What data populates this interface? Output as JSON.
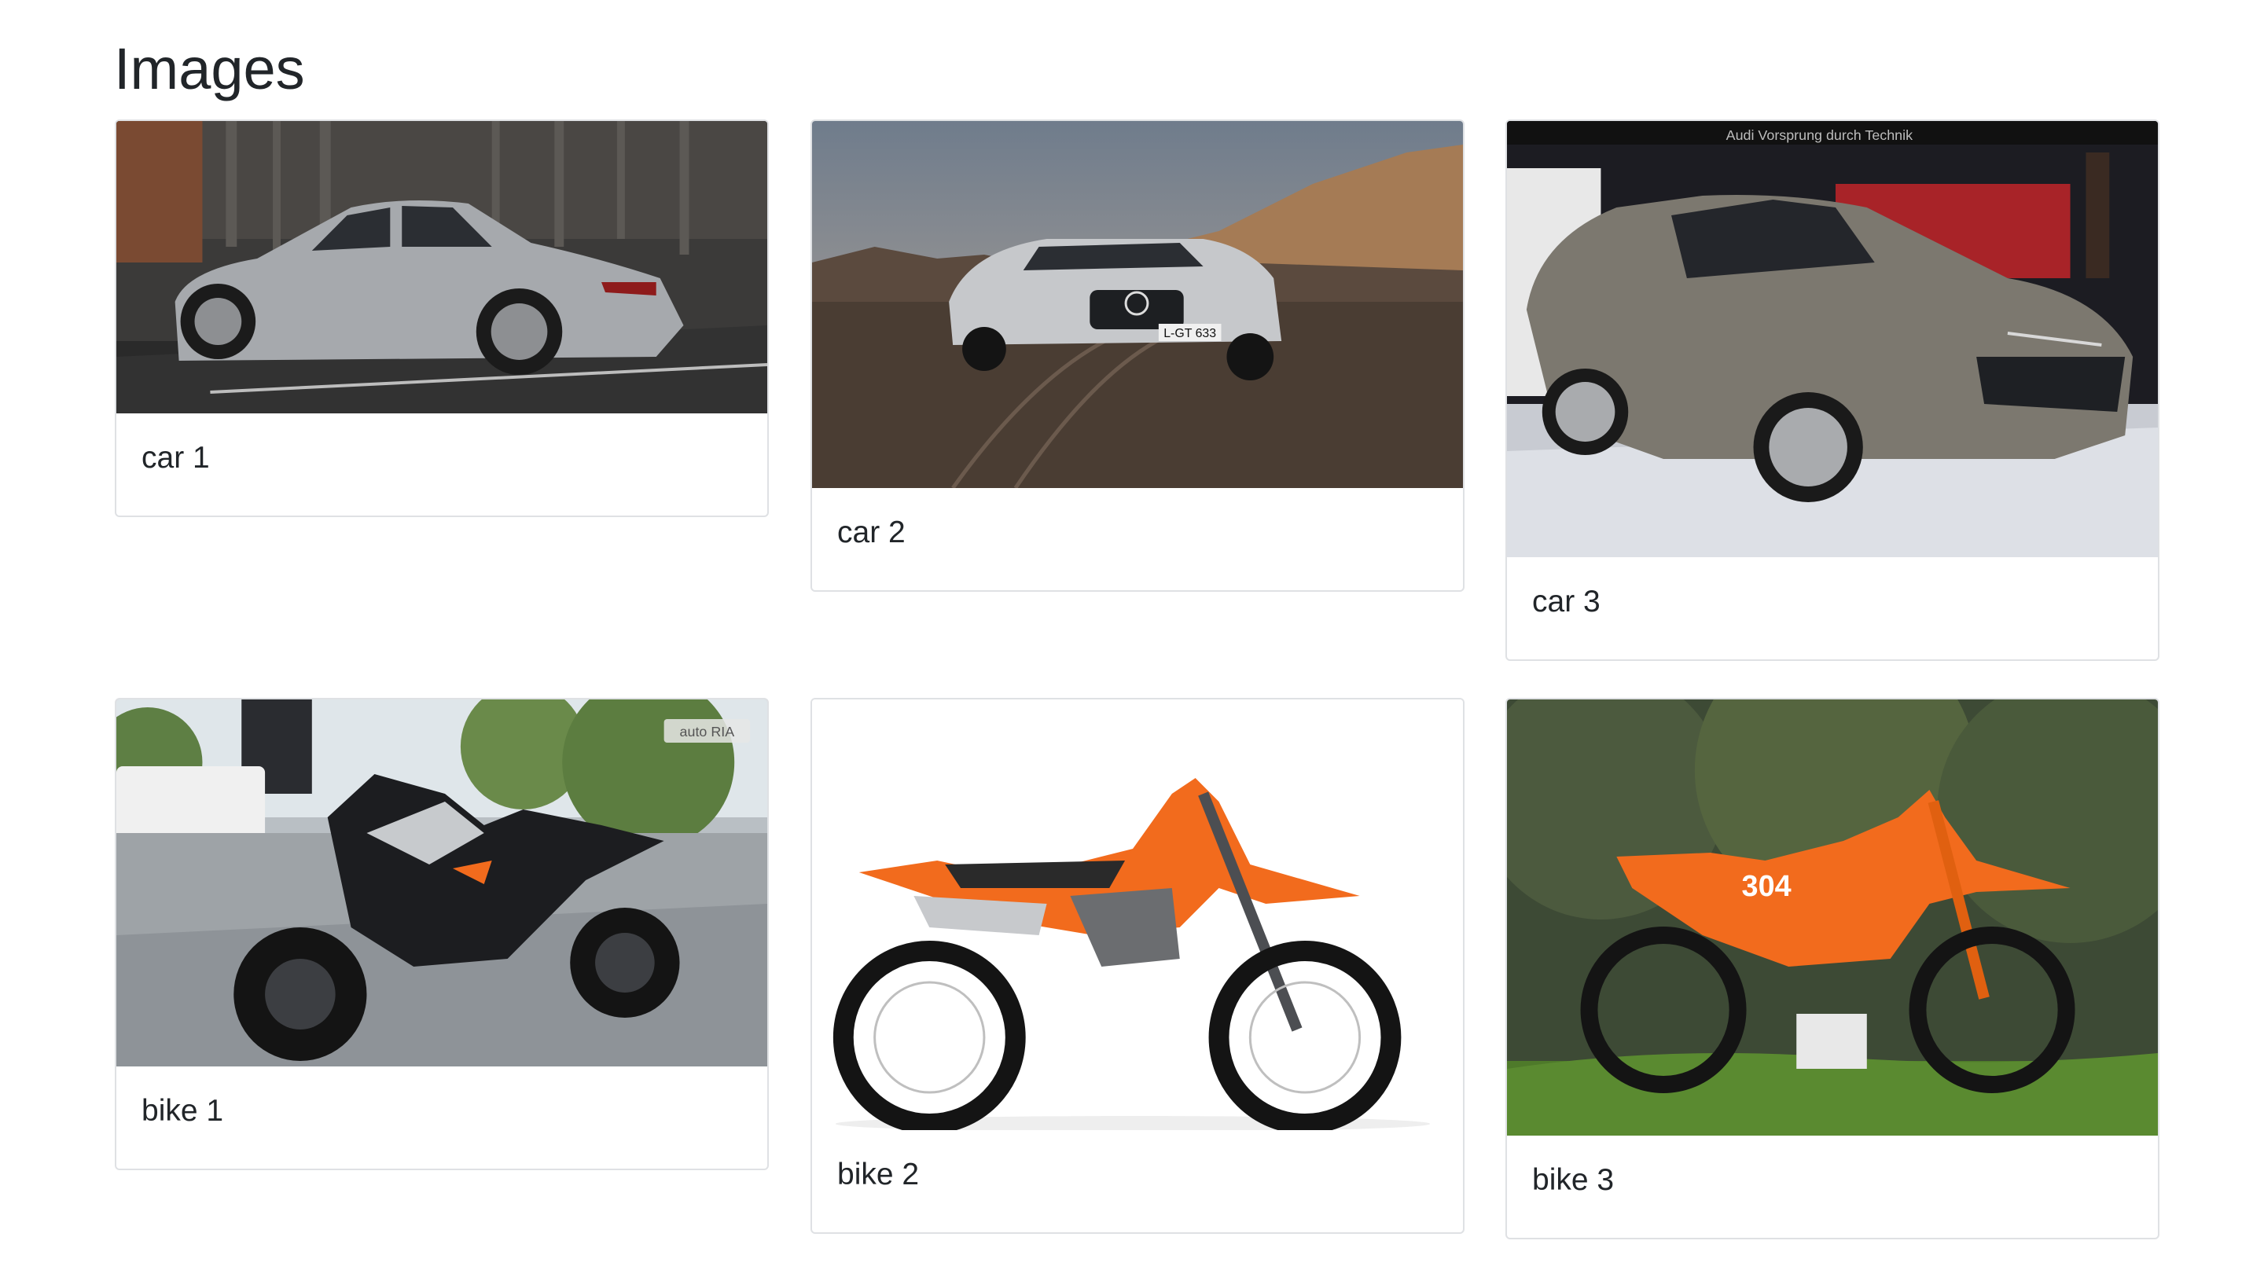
{
  "page": {
    "title": "Images"
  },
  "cards": [
    {
      "title": "car 1",
      "image_alt": "silver sedan driving on road"
    },
    {
      "title": "car 2",
      "image_alt": "silver sports car in desert"
    },
    {
      "title": "car 3",
      "image_alt": "grey sportback at auto show"
    },
    {
      "title": "bike 1",
      "image_alt": "naked motorcycle parked in lot"
    },
    {
      "title": "bike 2",
      "image_alt": "orange enduro bike on white background"
    },
    {
      "title": "bike 3",
      "image_alt": "orange enduro bike on grass"
    }
  ],
  "image_text": {
    "car2_plate": "L-GT 633",
    "car3_banner": "Audi Vorsprung durch Technik",
    "bike1_watermark": "auto RIA",
    "bike3_number": "304"
  },
  "colors": {
    "border": "#dfe1e4",
    "text": "#212529",
    "ktm_orange": "#f26b1d"
  }
}
